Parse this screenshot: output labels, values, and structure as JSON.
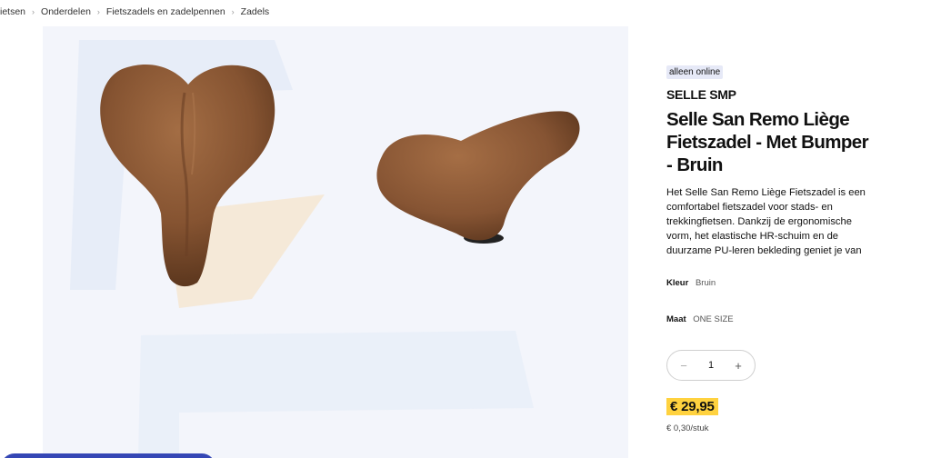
{
  "breadcrumb": {
    "items": [
      "ietsen",
      "Onderdelen",
      "Fietszadels en zadelpennen",
      "Zadels"
    ],
    "separator": "›"
  },
  "product": {
    "badge": "alleen online",
    "brand": "SELLE SMP",
    "title_lines": [
      "Selle San Remo Liège",
      "Fietszadel - Met Bumper",
      "- Bruin"
    ],
    "description_lines": [
      "Het Selle San Remo Liège Fietszadel is een",
      "comfortabel fietszadel voor stads- en",
      "trekkingfietsen. Dankzij de ergonomische",
      "vorm, het elastische HR-schuim en de",
      "duurzame PU-leren bekleding geniet je van"
    ],
    "color": {
      "label": "Kleur",
      "value": "Bruin"
    },
    "size": {
      "label": "Maat",
      "value": "ONE SIZE"
    },
    "quantity": {
      "minus": "−",
      "value": "1",
      "plus": "+"
    },
    "price": "€ 29,95",
    "unit_price": "€ 0,30/stuk"
  },
  "colors": {
    "gallery_bg": "#f3f5fb",
    "price_highlight": "#ffd23f",
    "badge_bg": "#e6e9f7",
    "cta": "#3547b5",
    "saddle_brown": "#8a5a35"
  },
  "icons": {
    "breadcrumb_separator": "chevron-right-icon",
    "quantity_decrease": "minus-icon",
    "quantity_increase": "plus-icon"
  }
}
